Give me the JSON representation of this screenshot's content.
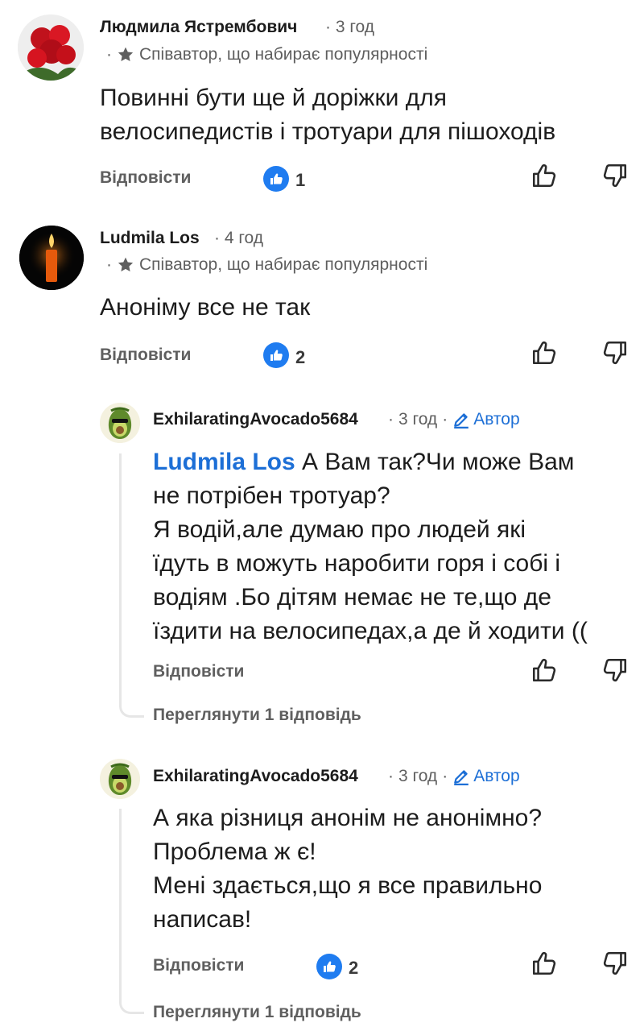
{
  "comments": [
    {
      "author": "Людмила Ястрембович",
      "time": "3 год",
      "flair": "Співавтор, що набирає популярності",
      "text": "Повинні бути ще й доріжки для\nвелосипедистів і тротуари для пішоходів",
      "reply_label": "Відповісти",
      "likes": "1"
    },
    {
      "author": "Ludmila Los",
      "time": "4 год",
      "flair": "Співавтор, що набирає популярності",
      "text": "Аноніму все не так",
      "reply_label": "Відповісти",
      "likes": "2"
    }
  ],
  "replies": [
    {
      "author": "ExhilaratingAvocado5684",
      "time": "3 год",
      "author_badge": "Автор",
      "mention": "Ludmila Los",
      "text": "А Вам так?Чи може Вам\nне потрібен тротуар?\nЯ водій,але думаю про людей які\nїдуть в можуть наробити горя і собі і\nводіям .Бо дітям немає не те,що де\nїздити на велосипедах,а де й ходити ((",
      "reply_label": "Відповісти",
      "view_replies": "Переглянути 1 відповідь"
    },
    {
      "author": "ExhilaratingAvocado5684",
      "time": "3 год",
      "author_badge": "Автор",
      "text": "А яка різниця анонім не анонімно?\nПроблема ж є!\nМені здається,що я все правильно\nнаписав!",
      "reply_label": "Відповісти",
      "likes": "2",
      "view_replies": "Переглянути 1 відповідь"
    }
  ],
  "colors": {
    "accent": "#1d6fd6",
    "like_badge": "#1f7cf0",
    "muted": "#5f5f5f"
  },
  "icons": [
    "star-icon",
    "pencil-icon",
    "thumbs-up-icon",
    "thumbs-down-icon",
    "like-badge-icon"
  ]
}
